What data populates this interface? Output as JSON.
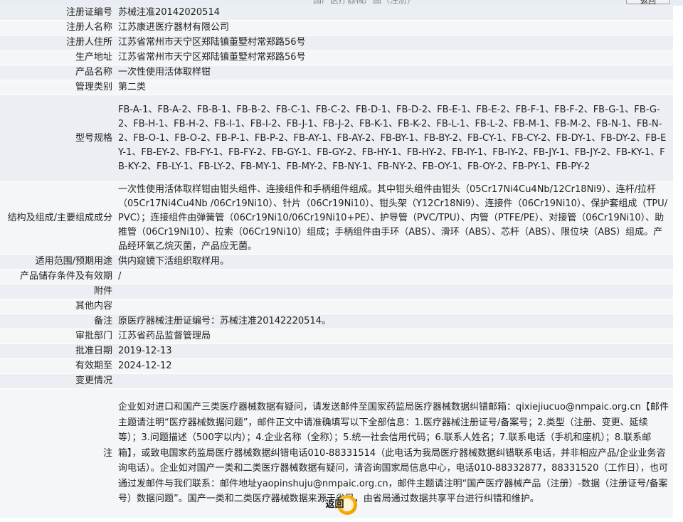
{
  "top": {
    "title": "国产医疗器械产品（注册）",
    "back_label": "返回"
  },
  "rows": [
    {
      "label": "注册证编号",
      "value": "苏械注准20142020514"
    },
    {
      "label": "注册人名称",
      "value": "江苏康进医疗器材有限公司"
    },
    {
      "label": "注册人住所",
      "value": "江苏省常州市天宁区郑陆镇董墅村常郑路56号"
    },
    {
      "label": "生产地址",
      "value": "江苏省常州市天宁区郑陆镇董墅村常郑路56号"
    },
    {
      "label": "产品名称",
      "value": "一次性使用活体取样钳"
    },
    {
      "label": "管理类别",
      "value": "第二类"
    },
    {
      "label": "型号规格",
      "value": "FB-A-1、FB-A-2、FB-B-1、FB-B-2、FB-C-1、FB-C-2、FB-D-1、FB-D-2、FB-E-1、FB-E-2、FB-F-1、FB-F-2、FB-G-1、FB-G-2、FB-H-1、FB-H-2、FB-I-1、FB-I-2、FB-J-1、FB-J-2、FB-K-1、FB-K-2、FB-L-1、FB-L-2、FB-M-1、FB-M-2、FB-N-1、FB-N-2、FB-O-1、FB-O-2、FB-P-1、FB-P-2、FB-AY-1、FB-AY-2、FB-BY-1、FB-BY-2、FB-CY-1、FB-CY-2、FB-DY-1、FB-DY-2、FB-EY-1、FB-EY-2、FB-FY-1、FB-FY-2、FB-GY-1、FB-GY-2、FB-HY-1、FB-HY-2、FB-IY-1、FB-IY-2、FB-JY-1、FB-JY-2、FB-KY-1、FB-KY-2、FB-LY-1、FB-LY-2、FB-MY-1、FB-MY-2、FB-NY-1、FB-NY-2、FB-OY-1、FB-OY-2、FB-PY-1、FB-PY-2"
    },
    {
      "label": "结构及组成/主要组成成分",
      "value": "一次性使用活体取样钳由钳头组件、连接组件和手柄组件组成。其中钳头组件由钳头（05Cr17Ni4Cu4Nb/12Cr18Ni9）、连杆/拉杆（05Cr17Ni4Cu4Nb /06Cr19Ni10）、针片（06Cr19Ni10）、钳头架（Y12Cr18Ni9）、连接件（06Cr19Ni10）、保护套组成（TPU/PVC）；连接组件由弹簧管（06Cr19Ni10/06Cr19Ni10+PE）、护导管（PVC/TPU）、内管（PTFE/PE）、对接管（06Cr19Ni10）、助推管（06Cr19Ni10）、拉索（06Cr19Ni10）组成；手柄组件由手环（ABS）、滑环（ABS）、芯杆（ABS）、限位块（ABS）组成。产品经环氧乙烷灭菌，产品应无菌。"
    },
    {
      "label": "适用范围/预期用途",
      "value": "供内窥镜下活组织取样用。"
    },
    {
      "label": "产品储存条件及有效期",
      "value": "/"
    },
    {
      "label": "附件",
      "value": ""
    },
    {
      "label": "其他内容",
      "value": ""
    },
    {
      "label": "备注",
      "value": "原医疗器械注册证编号：苏械注准20142220514。"
    },
    {
      "label": "审批部门",
      "value": "江苏省药品监督管理局"
    },
    {
      "label": "批准日期",
      "value": "2019-12-13"
    },
    {
      "label": "有效期至",
      "value": "2024-12-12"
    },
    {
      "label": "变更情况",
      "value": ""
    },
    {
      "label": "注",
      "value": "企业如对进口和国产三类医疗器械数据有疑问，请发送邮件至国家药监局医疗器械数据纠错邮箱：qixiejiucuo@nmpaic.org.cn【邮件主题请注明“医疗器械数据问题”，邮件正文中请准确填写以下全部信息：1.医疗器械注册证号/备案号；2.类型（注册、变更、延续等）；3.问题描述（500字以内）；4.企业名称（全称）；5.统一社会信用代码；6.联系人姓名；7.联系电话（手机和座机）；8.联系邮箱】，或致电国家药监局医疗器械数据纠错电话010-88331514（此电话为我局医疗器械数据纠错联系电话，并非相应产品/企业业务咨询电话）。企业如对国产一类和二类医疗器械数据有疑问，请咨询国家局信息中心，电话010-88332877，88331520（工作日），也可通过发邮件与我们联系：邮件地址yaopinshuju@nmpaic.org.cn，邮件主题请注明“国产医疗器械产品（注册）-数据（注册证号/备案号）数据问题”。国产一类和二类医疗器械数据来源于省局，由省局通过数据共享平台进行纠错和维护。"
    }
  ],
  "footer": {
    "back_label": "返回"
  }
}
